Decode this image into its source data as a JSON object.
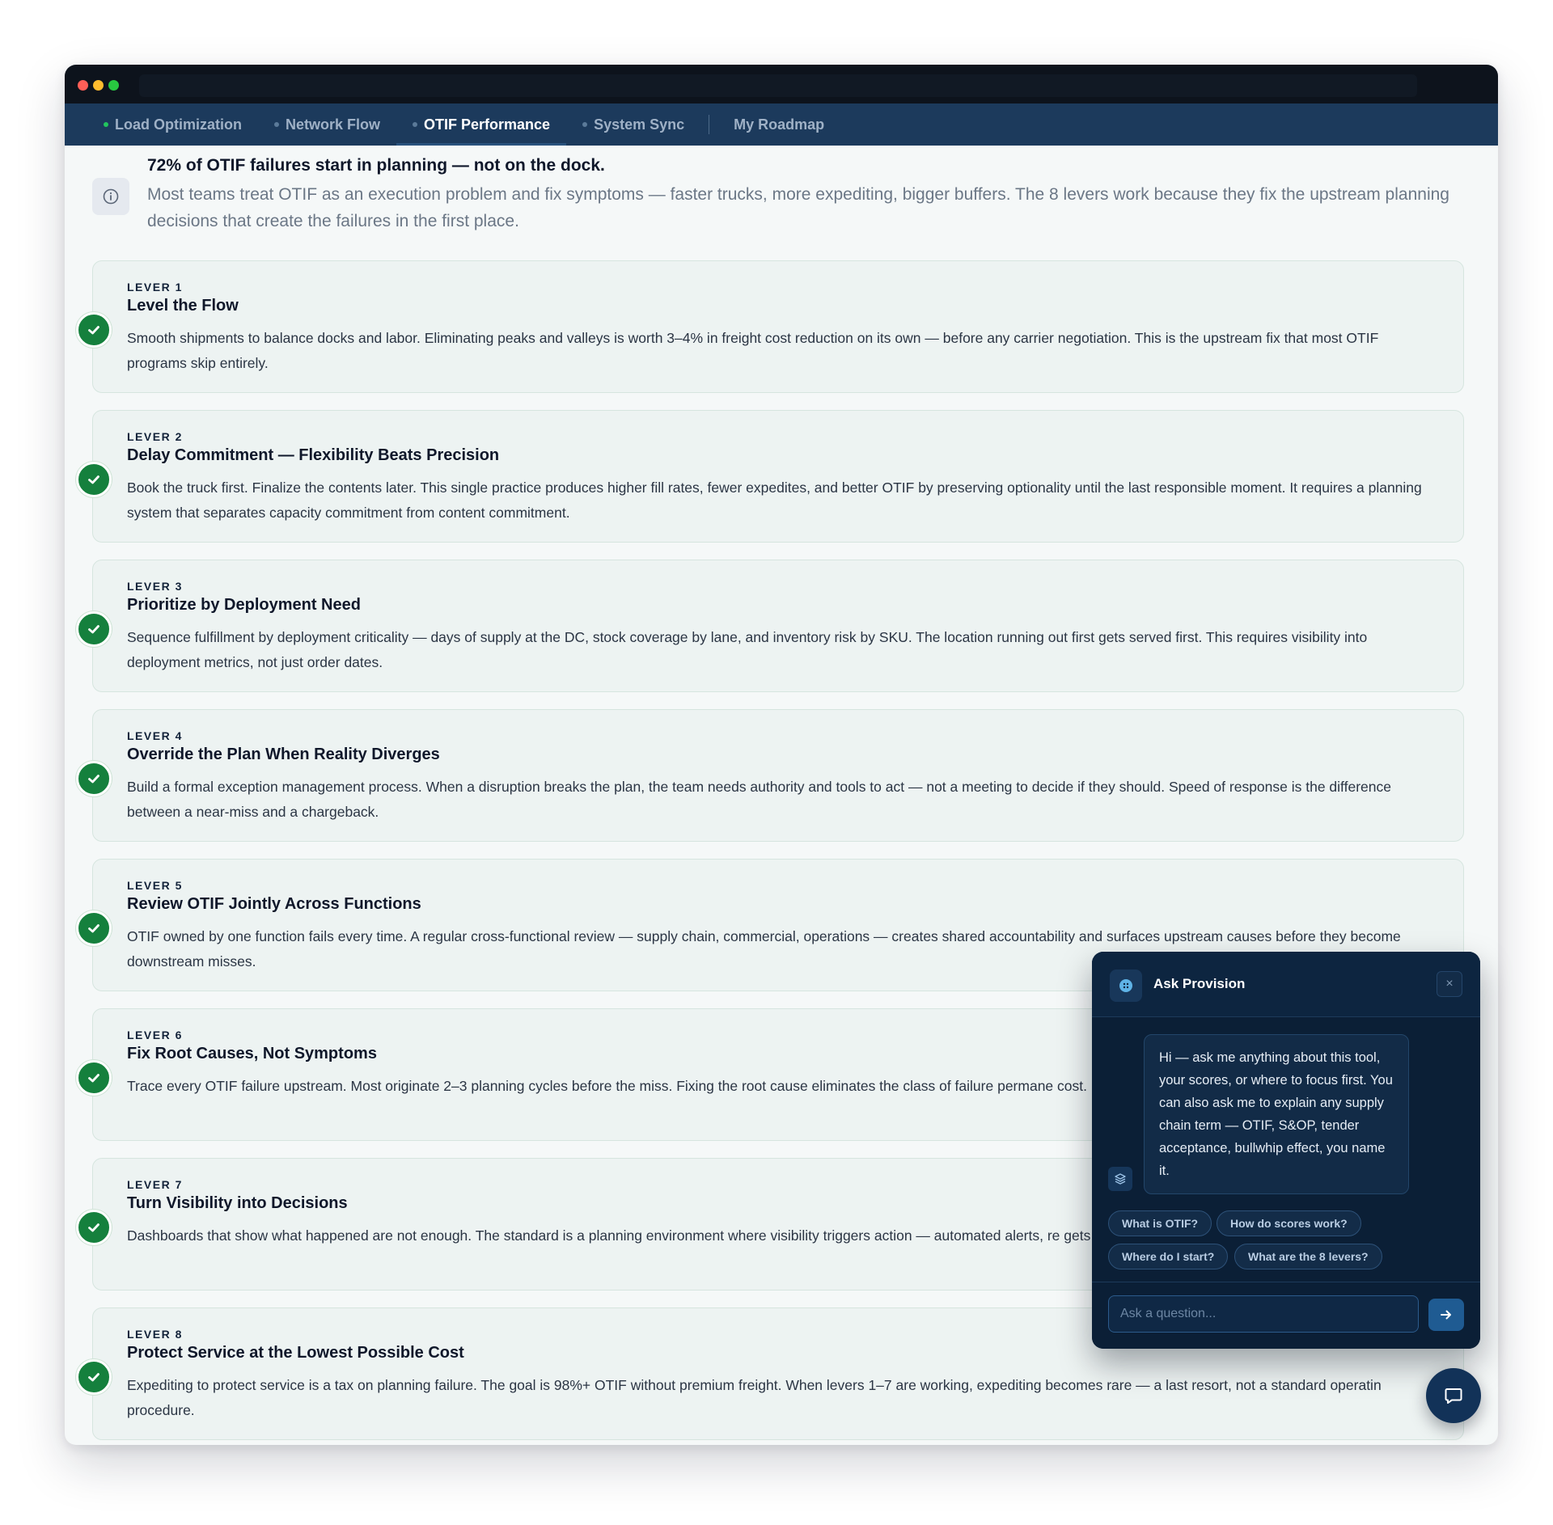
{
  "tabs": [
    {
      "label": "Load Optimization",
      "dot": "live"
    },
    {
      "label": "Network Flow",
      "dot": "idle"
    },
    {
      "label": "OTIF Performance",
      "dot": "idle"
    },
    {
      "label": "System Sync",
      "dot": "idle"
    },
    {
      "label": "My Roadmap",
      "dot": "none"
    }
  ],
  "active_tab": "OTIF Performance",
  "callout": {
    "icon": "info-icon",
    "title": "72% of OTIF failures start in planning — not on the dock.",
    "body": "Most teams treat OTIF as an execution problem and fix symptoms — faster trucks, more expediting, bigger buffers. The 8 levers work because they fix the upstream planning decisions that create the failures in the first place."
  },
  "levers": [
    {
      "num": "LEVER 1",
      "title": "Level the Flow",
      "desc": "Smooth shipments to balance docks and labor. Eliminating peaks and valleys is worth 3–4% in freight cost reduction on its own — before any carrier negotiation. This is the upstream fix that most OTIF programs skip entirely.",
      "status": "complete"
    },
    {
      "num": "LEVER 2",
      "title": "Delay Commitment — Flexibility Beats Precision",
      "desc": "Book the truck first. Finalize the contents later. This single practice produces higher fill rates, fewer expedites, and better OTIF by preserving optionality until the last responsible moment. It requires a planning system that separates capacity commitment from content commitment.",
      "status": "complete"
    },
    {
      "num": "LEVER 3",
      "title": "Prioritize by Deployment Need",
      "desc": "Sequence fulfillment by deployment criticality — days of supply at the DC, stock coverage by lane, and inventory risk by SKU. The location running out first gets served first. This requires visibility into deployment metrics, not just order dates.",
      "status": "complete"
    },
    {
      "num": "LEVER 4",
      "title": "Override the Plan When Reality Diverges",
      "desc": "Build a formal exception management process. When a disruption breaks the plan, the team needs authority and tools to act — not a meeting to decide if they should. Speed of response is the difference between a near-miss and a chargeback.",
      "status": "complete"
    },
    {
      "num": "LEVER 5",
      "title": "Review OTIF Jointly Across Functions",
      "desc": "OTIF owned by one function fails every time. A regular cross-functional review — supply chain, commercial, operations — creates shared accountability and surfaces upstream causes before they become downstream misses.",
      "status": "complete"
    },
    {
      "num": "LEVER 6",
      "title": "Fix Root Causes, Not Symptoms",
      "desc": "Trace every OTIF failure upstream. Most originate 2–3 planning cycles before the miss. Fixing the root cause eliminates the class of failure permane cost.",
      "status": "complete"
    },
    {
      "num": "LEVER 7",
      "title": "Turn Visibility into Decisions",
      "desc": "Dashboards that show what happened are not enough. The standard is a planning environment where visibility triggers action — automated alerts, re gets the right person acting on the right signal in time.",
      "status": "complete"
    },
    {
      "num": "LEVER 8",
      "title": "Protect Service at the Lowest Possible Cost",
      "desc": "Expediting to protect service is a tax on planning failure. The goal is 98%+ OTIF without premium freight. When levers 1–7 are working, expediting becomes rare — a last resort, not a standard operatin procedure.",
      "status": "complete"
    }
  ],
  "chat": {
    "title": "Ask Provision",
    "close_label": "×",
    "message": "Hi — ask me anything about this tool, your scores, or where to focus first. You can also ask me to explain any supply chain term — OTIF, S&OP, tender acceptance, bullwhip effect, you name it.",
    "chips": [
      "What is OTIF?",
      "How do scores work?",
      "Where do I start?",
      "What are the 8 levers?"
    ],
    "input_placeholder": "Ask a question...",
    "input_value": ""
  },
  "colors": {
    "tabbar": "#1c3a5c",
    "titlebar": "#0d131c",
    "check": "#15803d",
    "chat_bg": "#0b1f36",
    "accent": "#1f5b92"
  }
}
